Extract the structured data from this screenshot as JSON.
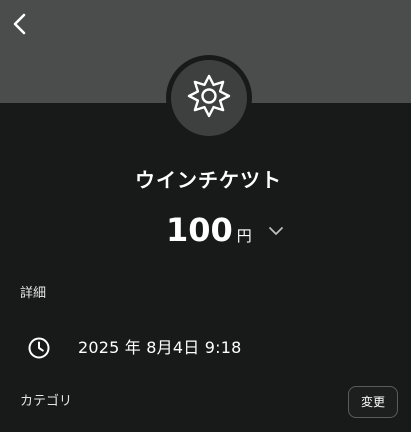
{
  "header": {
    "back_icon": "chevron-left-icon",
    "category_icon": "sun-gear-icon"
  },
  "transaction": {
    "title": "ウインチケツト",
    "amount": "100",
    "currency_unit": "円",
    "amount_dropdown_icon": "chevron-down-icon"
  },
  "details": {
    "section_label": "詳細",
    "date_icon": "clock-icon",
    "date_text": "2025 年 8月4日 9:18"
  },
  "category": {
    "section_label": "カテゴリ",
    "change_label": "変更"
  },
  "colors": {
    "header_band": "#4b4c4c",
    "background": "#171a19",
    "icon_circle": "#3e403f",
    "text_primary": "#ffffff",
    "button_border": "#5a5c5b"
  }
}
